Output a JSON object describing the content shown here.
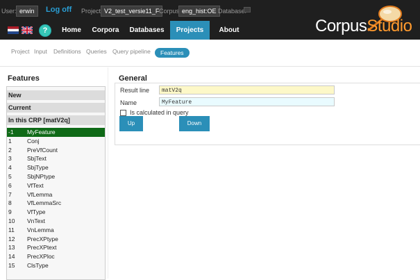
{
  "header": {
    "user_label": "User:",
    "user_value": "erwin",
    "logoff": "Log off",
    "project_label": "Project:",
    "project_value": "V2_test_versie11_F",
    "corpus_label": "Corpus:",
    "corpus_value": "eng_hist:OE",
    "database_label": "Database:",
    "database_value": "",
    "help_symbol": "?",
    "nav": [
      "Home",
      "Corpora",
      "Databases",
      "Projects",
      "About"
    ],
    "active_nav": "Projects",
    "logo_part1": "Corpus",
    "logo_part2": "Studio"
  },
  "subnav": {
    "items": [
      "Project",
      "Input",
      "Definitions",
      "Queries",
      "Query pipeline"
    ],
    "active": "Features"
  },
  "features": {
    "title": "Features",
    "sections": [
      "New",
      "Current",
      "In this CRP [matV2q]"
    ],
    "rows": [
      {
        "num": "-1",
        "name": "MyFeature"
      },
      {
        "num": "1",
        "name": "Conj"
      },
      {
        "num": "2",
        "name": "PreVfCount"
      },
      {
        "num": "3",
        "name": "SbjText"
      },
      {
        "num": "4",
        "name": "SbjType"
      },
      {
        "num": "5",
        "name": "SbjNPtype"
      },
      {
        "num": "6",
        "name": "VfText"
      },
      {
        "num": "7",
        "name": "VfLemma"
      },
      {
        "num": "8",
        "name": "VfLemmaSrc"
      },
      {
        "num": "9",
        "name": "VfType"
      },
      {
        "num": "10",
        "name": "VnText"
      },
      {
        "num": "11",
        "name": "VnLemma"
      },
      {
        "num": "12",
        "name": "PrecXPtype"
      },
      {
        "num": "13",
        "name": "PrecXPtext"
      },
      {
        "num": "14",
        "name": "PrecXPloc"
      },
      {
        "num": "15",
        "name": "ClsType"
      }
    ]
  },
  "general": {
    "title": "General",
    "result_label": "Result line",
    "result_value": "matV2q",
    "name_label": "Name",
    "name_value": "MyFeature",
    "checkbox_label": "Is calculated in query",
    "checkbox_checked": false,
    "up_label": "Up",
    "down_label": "Down"
  },
  "colors": {
    "accent": "#2b8fb8",
    "header_bg": "#1f1f1f",
    "selected_row": "#0f6a17",
    "logo_studio": "#ff9a2e"
  }
}
